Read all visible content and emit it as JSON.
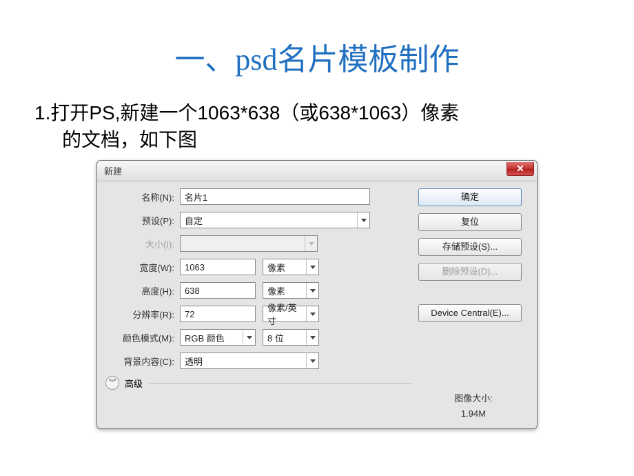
{
  "slide": {
    "title": "一、psd名片模板制作",
    "body_line1": "1.打开PS,新建一个1063*638（或638*1063）像素",
    "body_line2": "的文档，如下图"
  },
  "dialog": {
    "title": "新建",
    "close_symbol": "✕",
    "labels": {
      "name": "名称(N):",
      "preset": "预设(P):",
      "size": "大小(I):",
      "width": "宽度(W):",
      "height": "高度(H):",
      "resolution": "分辨率(R):",
      "color_mode": "颜色模式(M):",
      "bg": "背景内容(C):",
      "advanced": "高级",
      "image_size_label": "图像大小:",
      "image_size_value": "1.94M"
    },
    "values": {
      "name": "名片1",
      "preset": "自定",
      "size": "",
      "width": "1063",
      "height": "638",
      "resolution": "72",
      "unit_px": "像素",
      "unit_ppi": "像素/英寸",
      "color_mode": "RGB 颜色",
      "bit_depth": "8 位",
      "bg": "透明"
    },
    "buttons": {
      "ok": "确定",
      "reset": "复位",
      "save_preset": "存储预设(S)...",
      "delete_preset": "删除预设(D)...",
      "device_central": "Device Central(E)..."
    },
    "chevron": "︾"
  }
}
